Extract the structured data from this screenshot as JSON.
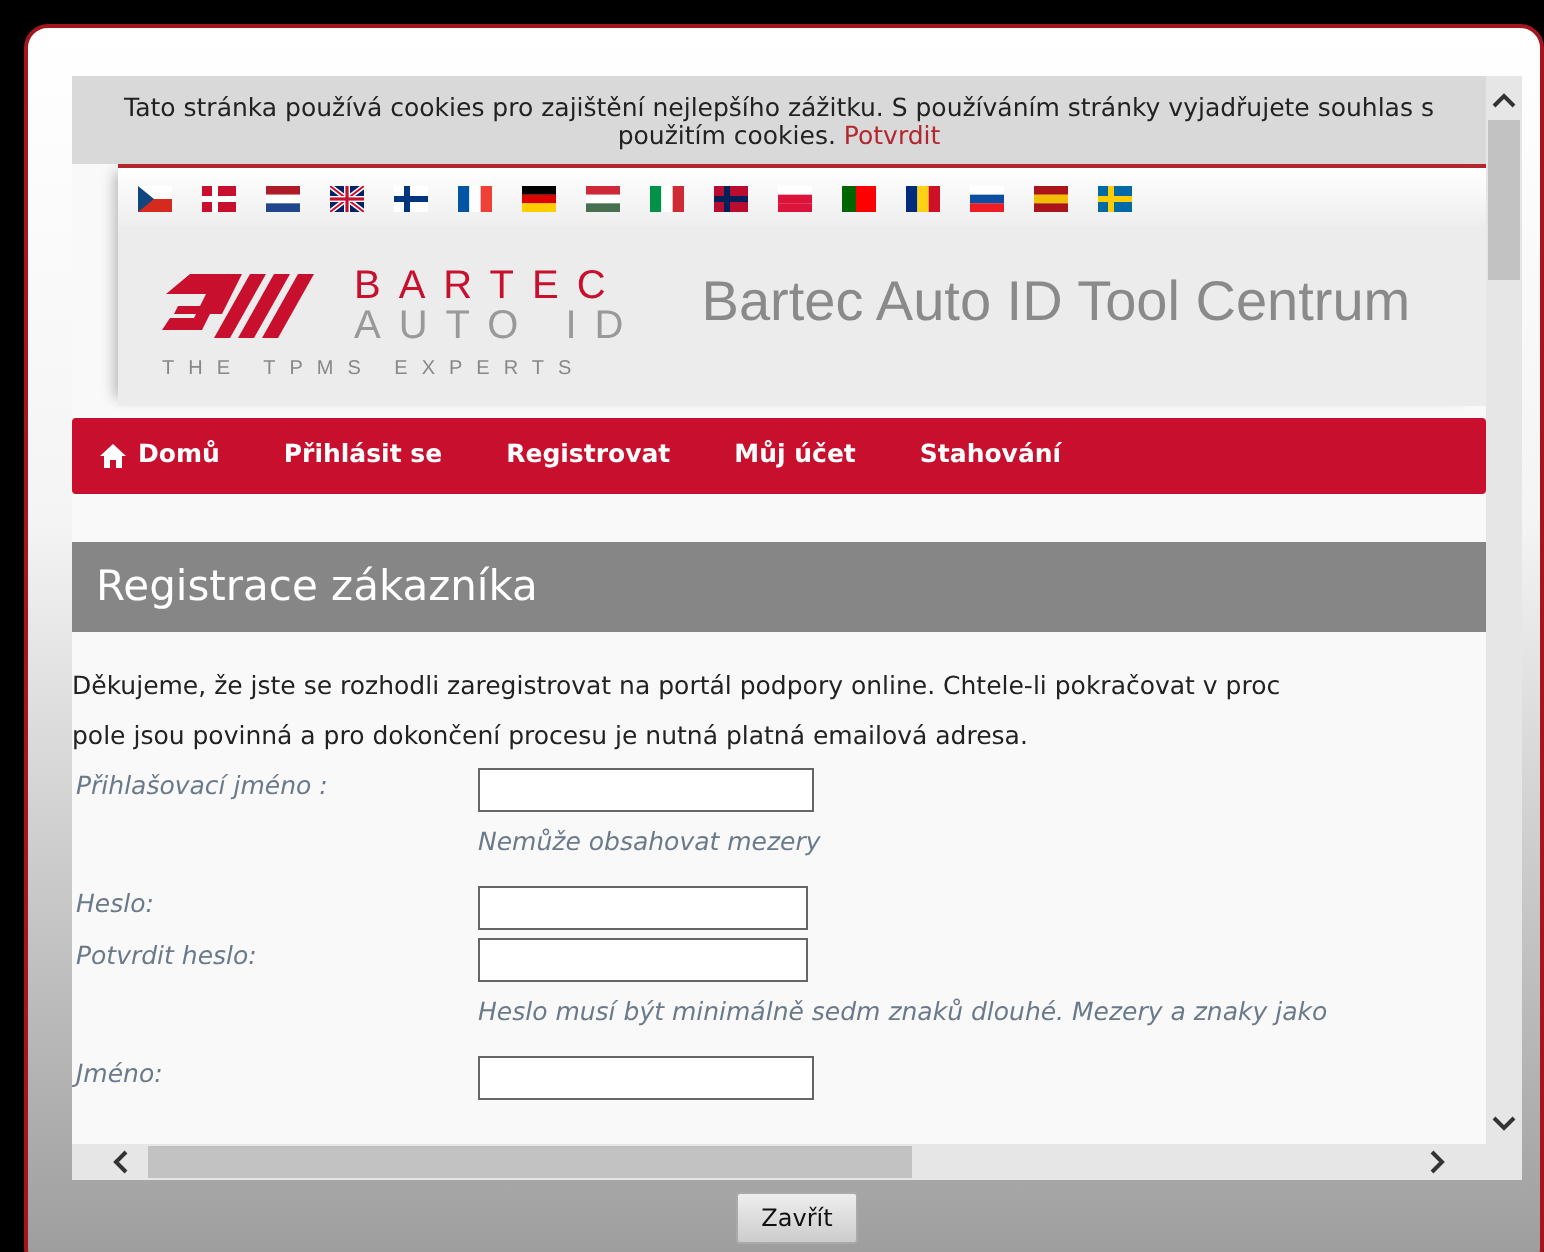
{
  "cookie_bar": {
    "text": "Tato stránka používá cookies pro zajištění nejlepšího zážitku. S používáním stránky vyjadřujete souhlas s použitím cookies.",
    "link": "Potvrdit"
  },
  "logo": {
    "brand": "BARTEC",
    "product": "AUTO ID",
    "tagline": "THE TPMS EXPERTS"
  },
  "site_title": "Bartec Auto ID Tool Centrum",
  "nav": [
    {
      "label": "Domů",
      "kind": "home"
    },
    {
      "label": "Přihlásit se",
      "kind": "link"
    },
    {
      "label": "Registrovat",
      "kind": "link"
    },
    {
      "label": "Můj účet",
      "kind": "link"
    },
    {
      "label": "Stahování",
      "kind": "link"
    }
  ],
  "heading": "Registrace zákazníka",
  "intro": [
    "Děkujeme, že jste se rozhodli zaregistrovat na portál podpory online. Chtele-li pokračovat v proc",
    "pole jsou povinná a pro dokončení procesu je nutná platná emailová adresa."
  ],
  "fields": [
    {
      "label": "Přihlašovací jméno :",
      "hint": "Nemůže obsahovat mezery"
    },
    {
      "label": "Heslo:"
    },
    {
      "label": "Potvrdit heslo:",
      "hint": "Heslo musí být minimálně sedm znaků dlouhé. Mezery a znaky jako"
    },
    {
      "label": "Jméno:"
    }
  ],
  "close_button": "Zavřít"
}
